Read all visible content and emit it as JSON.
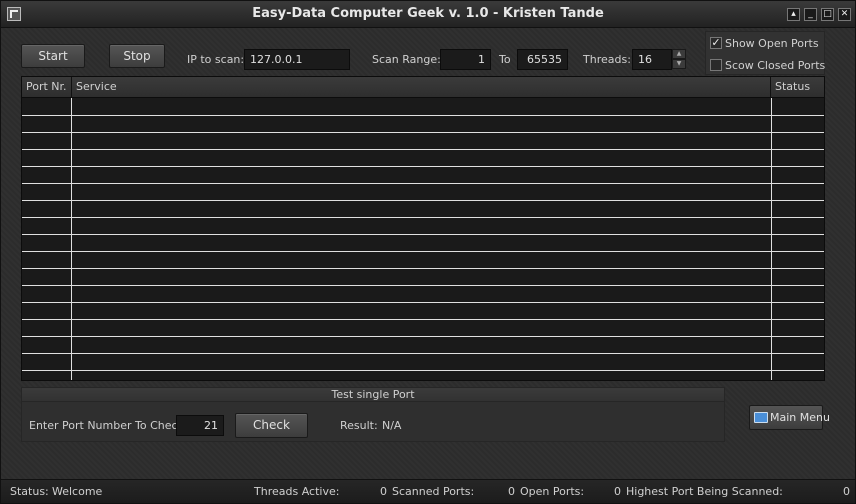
{
  "window": {
    "title": "Easy-Data Computer Geek v. 1.0 - Kristen Tande",
    "controls": [
      "▴",
      "_",
      "□",
      "✕"
    ]
  },
  "toolbar": {
    "start_label": "Start",
    "stop_label": "Stop",
    "ip_label": "IP to scan:",
    "ip_value": "127.0.0.1",
    "range_label": "Scan Range:",
    "range_from": "1",
    "to_label": "To",
    "range_to": "65535",
    "threads_label": "Threads:",
    "threads_value": "16"
  },
  "options": {
    "show_open_label": "Show Open Ports",
    "show_open_checked": true,
    "show_closed_label": "Scow Closed Ports",
    "show_closed_checked": false
  },
  "table": {
    "columns": [
      "Port Nr.",
      "Service",
      "Status"
    ],
    "rows": []
  },
  "test_port": {
    "section_title": "Test single Port",
    "enter_label": "Enter Port Number To Check:",
    "port_value": "21",
    "check_label": "Check",
    "result_label": "Result:",
    "result_value": "N/A"
  },
  "main_menu_label": "Main Menu",
  "status": {
    "status_label": "Status:",
    "status_value": "Welcome",
    "threads_active_label": "Threads Active:",
    "threads_active_value": "0",
    "scanned_label": "Scanned Ports:",
    "scanned_value": "0",
    "open_label": "Open Ports:",
    "open_value": "0",
    "highest_label": "Highest Port Being Scanned:",
    "highest_value": "0"
  },
  "colors": {
    "background": "#2c2c2c",
    "field": "#1b1b1b",
    "grid_line": "#e0e0e0",
    "accent_icon": "#4a8fd8"
  }
}
